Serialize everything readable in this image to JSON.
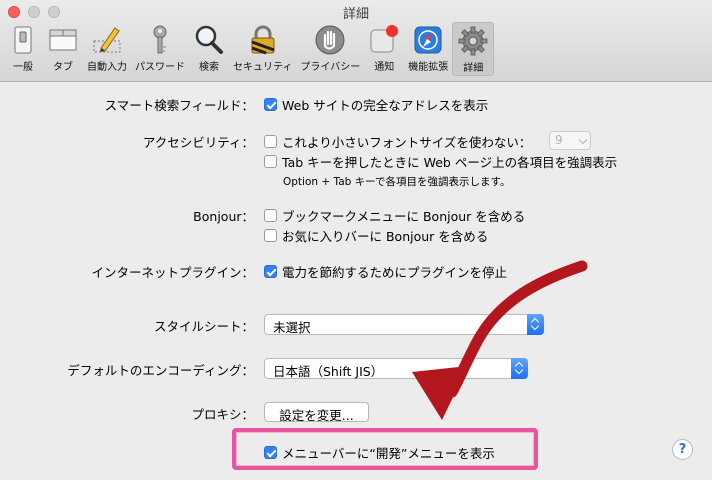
{
  "window": {
    "title": "詳細"
  },
  "toolbar": {
    "items": [
      {
        "label": "一般",
        "icon": "general-switch-icon"
      },
      {
        "label": "タブ",
        "icon": "tabs-icon"
      },
      {
        "label": "自動入力",
        "icon": "autofill-pencil-icon"
      },
      {
        "label": "パスワード",
        "icon": "key-icon"
      },
      {
        "label": "検索",
        "icon": "magnifier-icon"
      },
      {
        "label": "セキュリティ",
        "icon": "padlock-icon"
      },
      {
        "label": "プライバシー",
        "icon": "hand-icon"
      },
      {
        "label": "通知",
        "icon": "notification-badge-icon"
      },
      {
        "label": "機能拡張",
        "icon": "extensions-puzzle-icon"
      },
      {
        "label": "詳細",
        "icon": "gear-icon",
        "selected": true
      }
    ]
  },
  "settings": {
    "smart_search": {
      "label": "スマート検索フィールド：",
      "option": "Web サイトの完全なアドレスを表示",
      "checked": true
    },
    "accessibility": {
      "label": "アクセシビリティ：",
      "option1": "これより小さいフォントサイズを使わない：",
      "option1_checked": false,
      "font_size": "9",
      "option2": "Tab キーを押したときに Web ページ上の各項目を強調表示",
      "option2_checked": false,
      "note": "Option + Tab キーで各項目を強調表示します。"
    },
    "bonjour": {
      "label": "Bonjour：",
      "option1": "ブックマークメニューに Bonjour を含める",
      "option1_checked": false,
      "option2": "お気に入りバーに Bonjour を含める",
      "option2_checked": false
    },
    "plugins": {
      "label": "インターネットプラグイン：",
      "option": "電力を節約するためにプラグインを停止",
      "checked": true
    },
    "stylesheet": {
      "label": "スタイルシート：",
      "value": "未選択"
    },
    "encoding": {
      "label": "デフォルトのエンコーディング：",
      "value": "日本語（Shift JIS）"
    },
    "proxy": {
      "label": "プロキシ：",
      "button": "設定を変更..."
    },
    "develop_menu": {
      "option": "メニューバーに“開発”メニューを表示",
      "checked": true
    }
  },
  "help": {
    "label": "?"
  },
  "colors": {
    "accent": "#2f83f4",
    "annotation_arrow": "#b3171d",
    "annotation_box": "#e7559c"
  }
}
